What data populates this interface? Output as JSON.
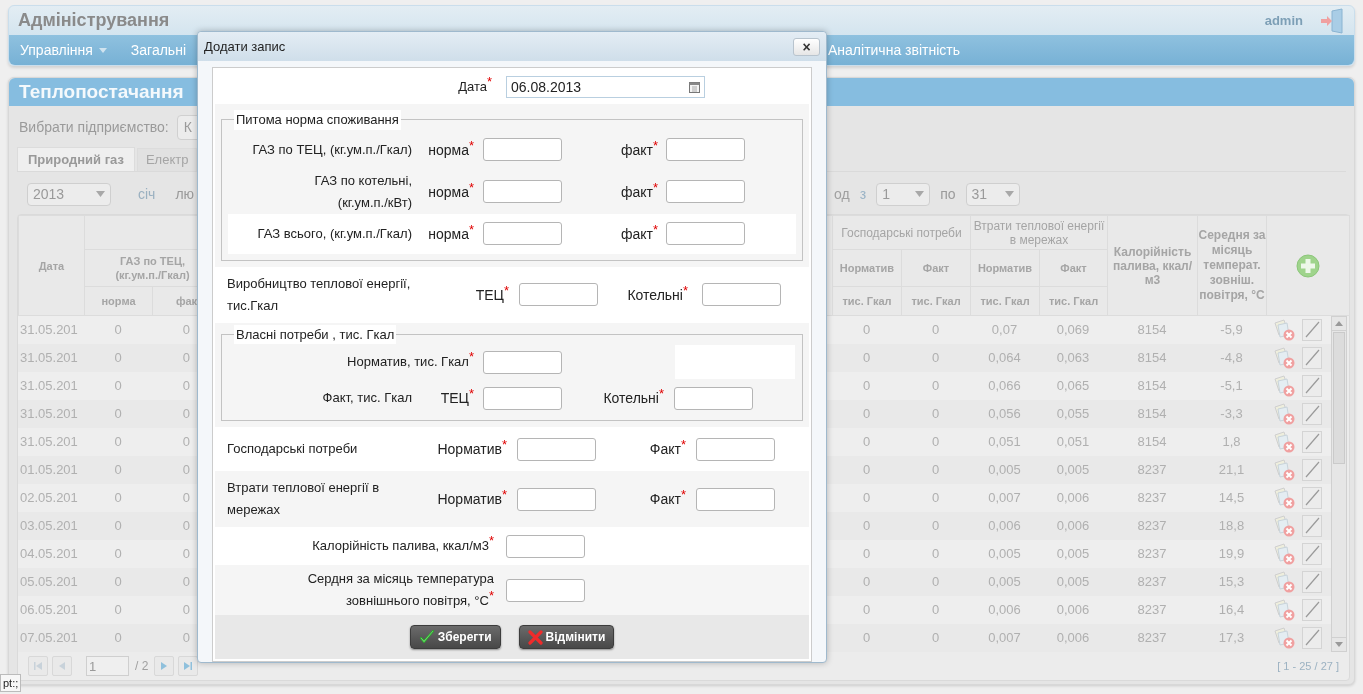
{
  "header": {
    "title": "Адміністрування",
    "user": "admin"
  },
  "nav": {
    "left": [
      {
        "label": "Управління",
        "dropdown": true
      },
      {
        "label": "Загальні",
        "dropdown": false
      }
    ],
    "right": [
      {
        "label": "Аналітична звітність",
        "dropdown": false
      }
    ]
  },
  "panel": {
    "title": "Теплопостачання",
    "company_label": "Вибрати підприємство:",
    "company_value": "К",
    "tabs": [
      {
        "label": "Природний газ",
        "selected": true
      },
      {
        "label": "Електр",
        "selected": false
      }
    ],
    "year": "2013",
    "months": [
      "січ",
      "лю"
    ],
    "period_label": "од",
    "from_label": "з",
    "from": "1",
    "to_label": "по",
    "to": "31"
  },
  "table": {
    "date_col": "Дата",
    "left_group": {
      "label": "ГАЗ по ТЕЦ, (кг.ум.п./Гкал)",
      "sub": [
        "норма",
        "фак"
      ]
    },
    "right_groups": [
      {
        "label": "Господарські потреби",
        "sub": [
          "Норматив",
          "Факт"
        ],
        "units": [
          "тис. Гкал",
          "тис. Гкал"
        ]
      },
      {
        "label": "Втрати теплової енергії в мережах",
        "sub": [
          "Норматив",
          "Факт"
        ],
        "units": [
          "тис. Гкал",
          "тис. Гкал"
        ]
      }
    ],
    "calorie_col": "Калорійність палива, ккал/м3",
    "temp_col": "Середня за місяць температ. зовніш. повітря, °С",
    "rows": [
      {
        "cells": [
          "31.05.201",
          "0",
          "0",
          "0",
          "0",
          "0,07",
          "0,069",
          "8154",
          "-5,9"
        ]
      },
      {
        "cells": [
          "31.05.201",
          "0",
          "0",
          "0",
          "0",
          "0,064",
          "0,063",
          "8154",
          "-4,8"
        ]
      },
      {
        "cells": [
          "31.05.201",
          "0",
          "0",
          "0",
          "0",
          "0,066",
          "0,065",
          "8154",
          "-5,1"
        ]
      },
      {
        "cells": [
          "31.05.201",
          "0",
          "0",
          "0",
          "0",
          "0,056",
          "0,055",
          "8154",
          "-3,3"
        ]
      },
      {
        "cells": [
          "31.05.201",
          "0",
          "0",
          "0",
          "0",
          "0,051",
          "0,051",
          "8154",
          "1,8"
        ]
      },
      {
        "cells": [
          "01.05.201",
          "0",
          "0",
          "0",
          "0",
          "0,005",
          "0,005",
          "8237",
          "21,1"
        ]
      },
      {
        "cells": [
          "02.05.201",
          "0",
          "0",
          "0",
          "0",
          "0,007",
          "0,006",
          "8237",
          "14,5"
        ]
      },
      {
        "cells": [
          "03.05.201",
          "0",
          "0",
          "0",
          "0",
          "0,006",
          "0,006",
          "8237",
          "18,8"
        ]
      },
      {
        "cells": [
          "04.05.201",
          "0",
          "0",
          "0",
          "0",
          "0,005",
          "0,005",
          "8237",
          "19,9"
        ]
      },
      {
        "cells": [
          "05.05.201",
          "0",
          "0",
          "0",
          "0",
          "0,005",
          "0,005",
          "8237",
          "15,3"
        ]
      },
      {
        "cells": [
          "06.05.201",
          "0",
          "0",
          "0",
          "0",
          "0,006",
          "0,006",
          "8237",
          "16,4"
        ]
      },
      {
        "cells": [
          "07.05.201",
          "0",
          "0",
          "0",
          "0",
          "0,007",
          "0,006",
          "8237",
          "17,3"
        ]
      }
    ]
  },
  "pager": {
    "buttons": [
      {
        "kind": "first",
        "disabled": true
      },
      {
        "kind": "prev",
        "disabled": true
      },
      {
        "kind": "next",
        "disabled": false
      },
      {
        "kind": "last",
        "disabled": false
      }
    ],
    "page": "1",
    "pages": "/ 2",
    "range": "[ 1 - 25 / 27 ]"
  },
  "status": "pt:;",
  "dialog": {
    "title": "Додати запис",
    "close": "×",
    "date": {
      "label": "Дата$^{*}$",
      "value": "06.08.2013"
    },
    "specific": {
      "legend": "Питома норма споживання",
      "rows": [
        {
          "label": [
            "ГАЗ по ТЕЦ, (кг.ум.п./Гкал)"
          ],
          "norm_label": "норма$^{*}$",
          "fact_label": "факт$^{*}$"
        },
        {
          "label": [
            "ГАЗ по котельні,",
            "(кг.ум.п./кВт)"
          ],
          "norm_label": "норма$^{*}$",
          "fact_label": "факт$^{*}$"
        },
        {
          "label": [
            "ГАЗ всього, (кг.ум.п./Гкал)"
          ],
          "norm_label": "норма$^{*}$",
          "fact_label": "факт$^{*}$"
        }
      ]
    },
    "production": {
      "label": [
        "Виробництво теплової енергії,",
        "тис.Гкал"
      ],
      "a": "ТЕЦ$^{*}$",
      "b": "Котельні$^{*}$"
    },
    "own": {
      "legend": "Власні потреби , тис. Гкал",
      "norm_label": "Норматив, тис. Гкал$^{*}$",
      "fact_label": "Факт, тис. Гкал",
      "a": "ТЕЦ$^{*}$",
      "b": "Котельні$^{*}$"
    },
    "pairs": [
      {
        "label": [
          "Господарські потреби"
        ],
        "a": "Норматив$^{*}$",
        "b": "Факт$^{*}$"
      },
      {
        "label": [
          "Втрати теплової енергії в",
          "мережах"
        ],
        "a": "Норматив$^{*}$",
        "b": "Факт$^{*}$"
      }
    ],
    "singles": [
      {
        "label": [
          "Калорійність палива, ккал/м3$^{*}$"
        ]
      },
      {
        "label": [
          "Сердня за місяць температура",
          "зовнішнього повітря, °С$^{*}$"
        ]
      }
    ],
    "buttons": [
      {
        "label": "Зберегти",
        "kind": "save"
      },
      {
        "label": "Відмінити",
        "kind": "cancel"
      }
    ]
  }
}
